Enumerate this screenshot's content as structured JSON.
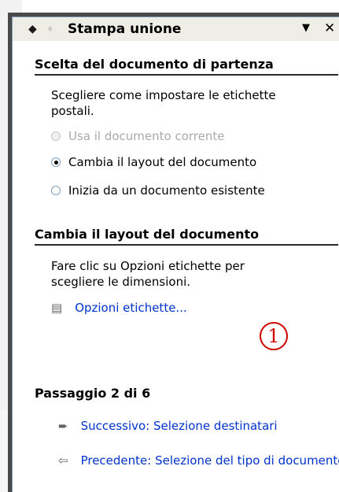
{
  "pane": {
    "title": "Stampa unione",
    "back_icon": "back-arrow-icon",
    "forward_icon": "forward-arrow-icon",
    "dropdown_glyph": "▼",
    "close_glyph": "✕"
  },
  "section1": {
    "heading": "Scelta del documento di partenza",
    "description_line1": "Scegliere come impostare le etichette",
    "description_line2": "postali.",
    "options": [
      {
        "label": "Usa il documento corrente",
        "selected": false,
        "enabled": false
      },
      {
        "label": "Cambia il layout del documento",
        "selected": true,
        "enabled": true
      },
      {
        "label": "Inizia da un documento esistente",
        "selected": false,
        "enabled": true
      }
    ]
  },
  "section2": {
    "heading": "Cambia il layout del documento",
    "description_line1": "Fare clic su Opzioni etichette per",
    "description_line2": "scegliere le dimensioni.",
    "link_label": "Opzioni etichette...",
    "annotation": "1"
  },
  "step": {
    "label": "Passaggio 2 di 6",
    "next_label": "Successivo: Selezione destinatari",
    "prev_label": "Precedente: Selezione del tipo di documento"
  },
  "colors": {
    "link": "#0033cc",
    "annotation": "#d00000",
    "titlebar_bg": "#efeee6"
  }
}
